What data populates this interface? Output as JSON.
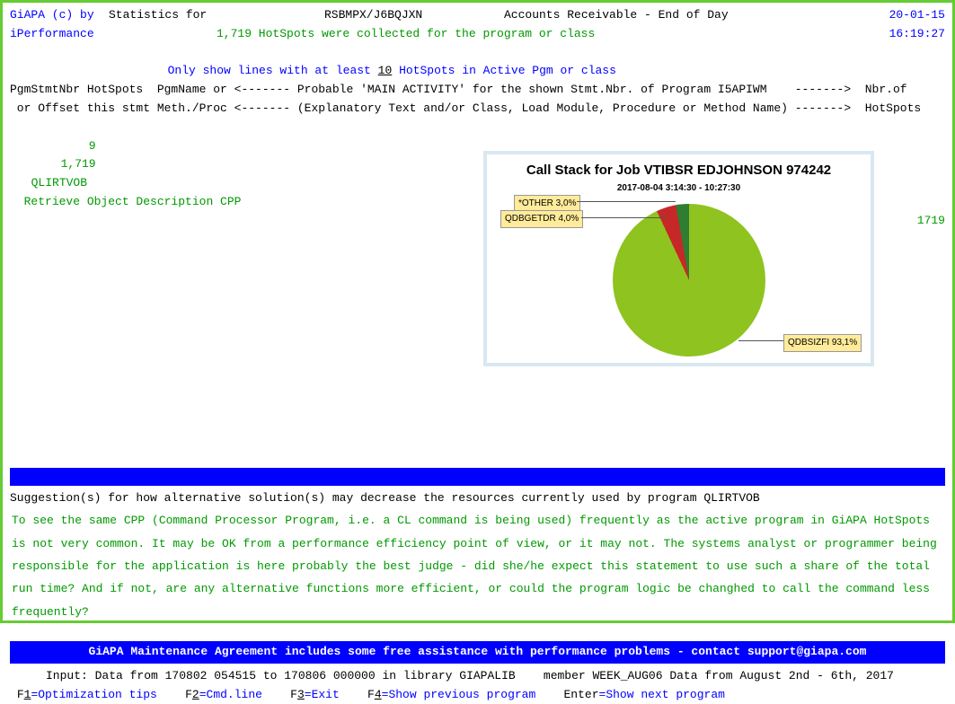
{
  "header": {
    "product": "GiAPA (c) by",
    "brand": "iPerformance",
    "stat_label": "Statistics for",
    "program_id": "RSBMPX/J6BQJXN",
    "desc": "Accounts Receivable - End of Day",
    "date": "20-01-15",
    "time": "16:19:27",
    "hotspots_line": "1,719 HotSpots were collected for the program or class",
    "filter_prefix": "Only show lines with at least ",
    "filter_value": "10",
    "filter_suffix": " HotSpots in Active Pgm or class"
  },
  "cols": {
    "line1": "PgmStmtNbr HotSpots  PgmName or <------- Probable 'MAIN ACTIVITY' for the shown Stmt.Nbr. of Program I5APIWM    ------->  Nbr.of",
    "line2": " or Offset this stmt Meth./Proc <------- (Explanatory Text and/or Class, Load Module, Procedure or Method Name) ------->  HotSpots"
  },
  "row": {
    "stmt": "9",
    "hotspots": "1,719",
    "pgm": "QLIRTVOB",
    "desc": "Retrieve Object Description CPP",
    "nbr": "1719"
  },
  "chart_data": {
    "type": "pie",
    "title": "Call Stack for Job VTIBSR EDJOHNSON 974242",
    "subtitle": "2017-08-04  3:14:30 - 10:27:30",
    "series": [
      {
        "name": "QDBSIZFI",
        "value": 93.1,
        "label": "QDBSIZFI 93,1%",
        "color": "#8fc31f"
      },
      {
        "name": "QDBGETDR",
        "value": 4.0,
        "label": "QDBGETDR 4,0%",
        "color": "#c62828"
      },
      {
        "name": "*OTHER",
        "value": 3.0,
        "label": "*OTHER 3,0%",
        "color": "#2e7d32"
      }
    ]
  },
  "suggestion_header": "Suggestion(s) for how alternative solution(s) may decrease the resources currently used by program QLIRTVOB",
  "suggestion_body": "To see the same CPP (Command Processor Program, i.e. a CL command is being used) frequently as the active program in GiAPA HotSpots is not very common. It may be OK from a performance efficiency point of view, or it may not. The systems analyst or programmer being responsible for the application is here probably the best judge - did she/he expect this statement to use such a share of the total run time? And if not, are any alternative functions more efficient, or could the program logic be changhed to call the command less frequently?",
  "maint_bar": "GiAPA Maintenance Agreement includes some free assistance with performance problems - contact support@giapa.com",
  "input_line": "Input: Data from 170802 054515 to 170806 000000 in library GIAPALIB    member WEEK_AUG06 Data from August 2nd - 6th, 2017",
  "fkeys": {
    "f1": "F1",
    "f1d": "=Optimization tips",
    "f2": "F2",
    "f2d": "=Cmd.line",
    "f3": "F3",
    "f3d": "=Exit",
    "f4": "F4",
    "f4d": "=Show previous program",
    "enter": "Enter",
    "enterd": "=Show next program"
  }
}
